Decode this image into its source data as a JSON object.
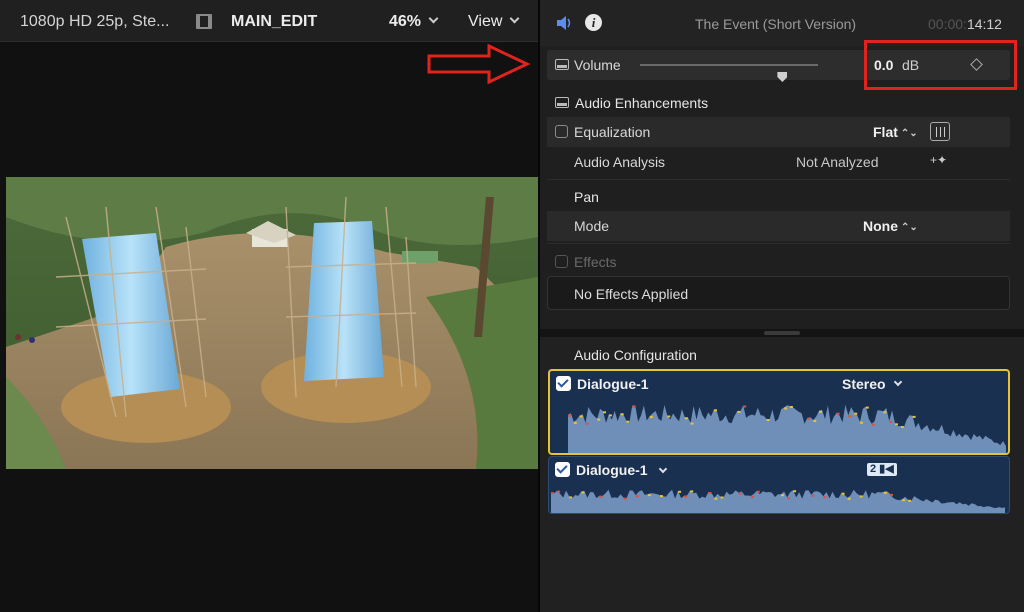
{
  "viewer": {
    "format": "1080p HD 25p, Ste...",
    "clip_name": "MAIN_EDIT",
    "zoom": "46%",
    "view_label": "View"
  },
  "inspector": {
    "event_title": "The Event (Short Version)",
    "timecode_dim": "00:00:",
    "timecode": "14:12",
    "volume": {
      "label": "Volume",
      "value": "0.0",
      "unit": "dB",
      "slider_level": 0.8
    },
    "enhancements": {
      "title": "Audio Enhancements",
      "eq_label": "Equalization",
      "eq_value": "Flat",
      "analysis_label": "Audio Analysis",
      "analysis_value": "Not Analyzed"
    },
    "pan": {
      "title": "Pan",
      "mode_label": "Mode",
      "mode_value": "None"
    },
    "effects": {
      "title": "Effects",
      "empty_text": "No Effects Applied"
    },
    "audio_config": {
      "title": "Audio Configuration",
      "tracks": [
        {
          "name": "Dialogue-1",
          "channel": "Stereo",
          "checked": true
        },
        {
          "name": "Dialogue-1",
          "channel_badge": "2",
          "checked": true
        }
      ]
    }
  },
  "colors": {
    "accent_blue": "#5b8dea",
    "highlight_red": "#e0231c",
    "selected_track_border": "#e6c236",
    "track_bg": "#1a3050"
  },
  "icons": [
    "film-icon",
    "chevron-down-icon",
    "speaker-icon",
    "info-icon",
    "panel-icon",
    "keyframe-icon",
    "equalizer-icon",
    "magic-wand-icon",
    "arrow-annotation-icon",
    "camera-icon"
  ]
}
